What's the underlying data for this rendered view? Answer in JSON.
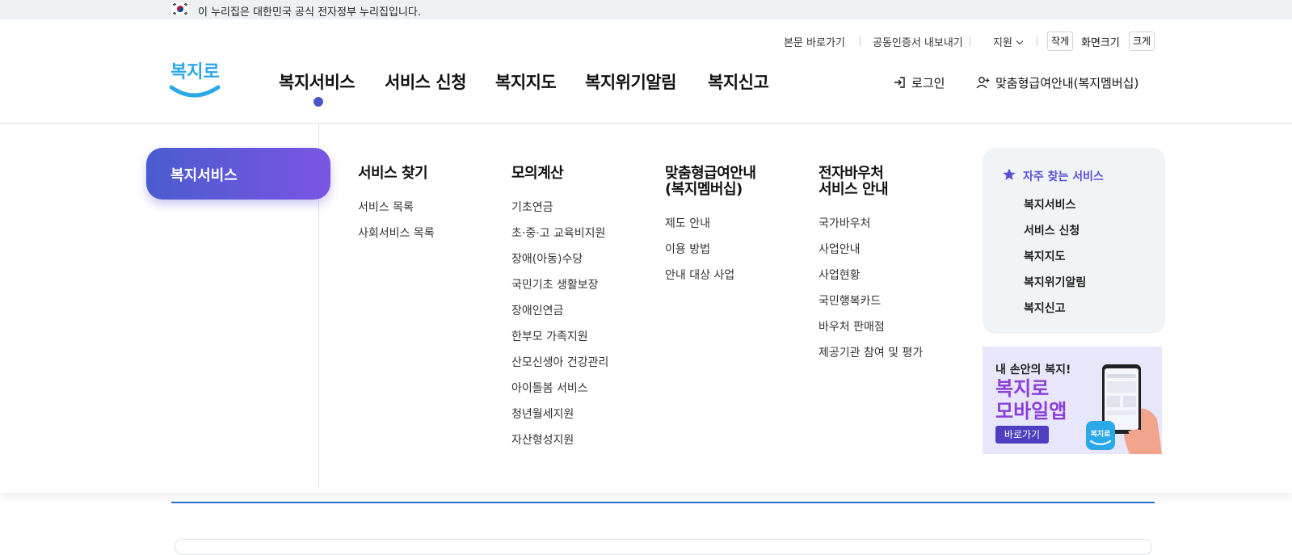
{
  "gov_banner": {
    "text": "이 누리집은 대한민국 공식 전자정부 누리집입니다."
  },
  "utility": {
    "skip_to_content": "본문 바로가기",
    "cert_export": "공동인증서 내보내기",
    "support": "지원",
    "font_small": "작게",
    "screen_size": "화면크기",
    "font_large": "크게"
  },
  "brand": {
    "logo_text": "복지로",
    "logo_color": "#2aa8e8"
  },
  "gnb": [
    "복지서비스",
    "서비스 신청",
    "복지지도",
    "복지위기알림",
    "복지신고"
  ],
  "account": {
    "login": "로그인",
    "membership": "맞춤형급여안내(복지멤버십)"
  },
  "mega": {
    "active_category": "복지서비스",
    "columns": [
      {
        "title": "서비스 찾기",
        "items": [
          "서비스 목록",
          "사회서비스 목록"
        ]
      },
      {
        "title": "모의계산",
        "items": [
          "기초연금",
          "초·중·고 교육비지원",
          "장애(아동)수당",
          "국민기초 생활보장",
          "장애인연금",
          "한부모 가족지원",
          "산모신생아 건강관리",
          "아이돌봄 서비스",
          "청년월세지원",
          "자산형성지원"
        ]
      },
      {
        "title_line1": "맞춤형급여안내",
        "title_line2": "(복지멤버십)",
        "items": [
          "제도 안내",
          "이용 방법",
          "안내 대상 사업"
        ]
      },
      {
        "title_line1": "전자바우처",
        "title_line2": "서비스 안내",
        "items": [
          "국가바우처",
          "사업안내",
          "사업현황",
          "국민행복카드",
          "바우처 판매점",
          "제공기관 참여 및 평가"
        ]
      }
    ]
  },
  "favorites": {
    "title": "자주 찾는 서비스",
    "items": [
      "복지서비스",
      "서비스 신청",
      "복지지도",
      "복지위기알림",
      "복지신고"
    ]
  },
  "app_banner": {
    "line1": "내 손안의 복지!",
    "line2": "복지로",
    "line3": "모바일앱",
    "button": "바로가기",
    "app_icon_text": "복지로"
  },
  "colors": {
    "accent": "#4a55c9",
    "pill_start": "#4a5ccf",
    "pill_end": "#7a55e2",
    "fav_title": "#5a4fd6",
    "app_purple": "#8b3fd8"
  }
}
